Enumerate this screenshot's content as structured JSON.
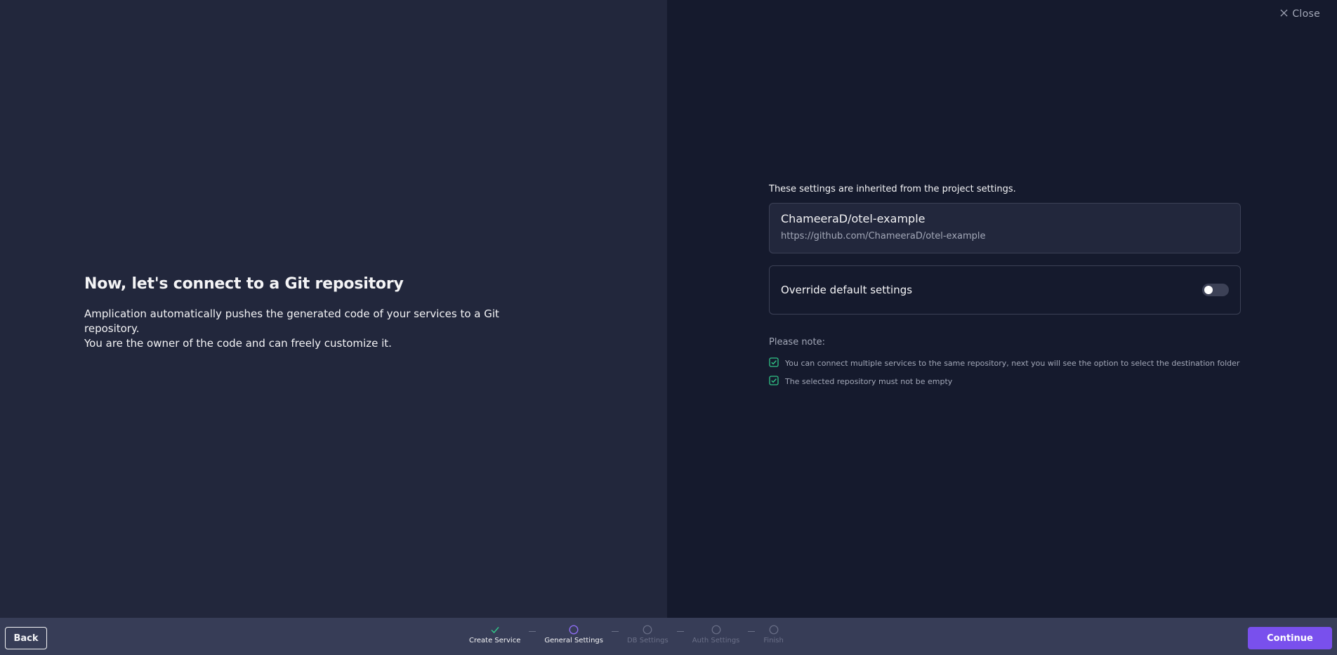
{
  "header": {
    "close_label": "Close"
  },
  "intro": {
    "title": "Now, let's connect to a Git repository",
    "line1": "Amplication automatically pushes the generated code of your services to a Git repository.",
    "line2": "You are the owner of the code and can freely customize it."
  },
  "settings": {
    "hint": "These settings are inherited from the project settings.",
    "repo_name": "ChameeraD/otel-example",
    "repo_url": "https://github.com/ChameeraD/otel-example",
    "override_label": "Override default settings",
    "override_enabled": false
  },
  "notes": {
    "title": "Please note:",
    "items": [
      "You can connect multiple services to the same repository, next you will see the option to select the destination folder",
      "The selected repository must not be empty"
    ]
  },
  "footer": {
    "back_label": "Back",
    "continue_label": "Continue",
    "steps": [
      {
        "label": "Create Service",
        "state": "done"
      },
      {
        "label": "General Settings",
        "state": "active"
      },
      {
        "label": "DB Settings",
        "state": "pending"
      },
      {
        "label": "Auth Settings",
        "state": "pending"
      },
      {
        "label": "Finish",
        "state": "pending"
      }
    ]
  },
  "colors": {
    "accent": "#7950ed",
    "check": "#31c587",
    "panel_left": "#22273c",
    "panel_right": "#151a2d",
    "footer": "#373d57"
  }
}
